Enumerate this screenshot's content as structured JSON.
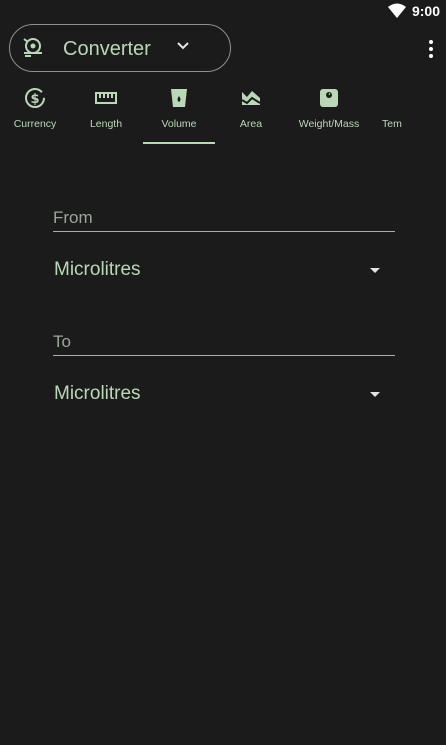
{
  "status_bar": {
    "time": "9:00"
  },
  "app_selector": {
    "title": "Converter"
  },
  "tabs": [
    {
      "label": "Currency",
      "icon": "currency-icon"
    },
    {
      "label": "Length",
      "icon": "ruler-icon"
    },
    {
      "label": "Volume",
      "icon": "cup-icon",
      "active": true
    },
    {
      "label": "Area",
      "icon": "area-icon"
    },
    {
      "label": "Weight/Mass",
      "icon": "scale-icon"
    },
    {
      "label": "Tem",
      "icon": "thermometer-icon"
    }
  ],
  "from": {
    "label": "From",
    "unit": "Microlitres"
  },
  "to": {
    "label": "To",
    "unit": "Microlitres"
  },
  "colors": {
    "accent": "#b9d8b6",
    "background": "#1b1b1b",
    "line": "#a8aea6"
  }
}
